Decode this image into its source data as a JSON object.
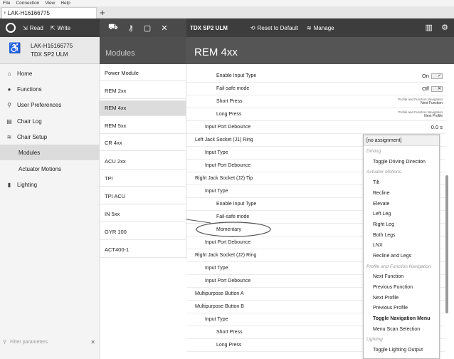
{
  "menubar": [
    "File",
    "Connection",
    "View",
    "Help"
  ],
  "tab": {
    "label": "LAK-H16166775",
    "new_tab": "+"
  },
  "toolbar": {
    "read_label": "Read",
    "write_label": "Write",
    "device_title": "TDX SP2 ULM",
    "reset_label": "Reset to Default",
    "manage_label": "Manage"
  },
  "device": {
    "name": "LAK-H16166775",
    "model": "TDX SP2 ULM"
  },
  "modules_header": "Modules",
  "page_title": "REM 4xx",
  "nav": [
    {
      "label": "Home",
      "icon": "home-icon",
      "glyph": "⌂"
    },
    {
      "label": "Functions",
      "icon": "functions-icon",
      "glyph": "●"
    },
    {
      "label": "User Preferences",
      "icon": "user-icon",
      "glyph": "⚲"
    },
    {
      "label": "Chair Log",
      "icon": "log-icon",
      "glyph": "▤"
    },
    {
      "label": "Chair Setup",
      "icon": "setup-icon",
      "glyph": "≋"
    },
    {
      "label": "Modules",
      "icon": "",
      "glyph": ""
    },
    {
      "label": "Actuator Motions",
      "icon": "",
      "glyph": ""
    },
    {
      "label": "Lighting",
      "icon": "lighting-icon",
      "glyph": "▮"
    }
  ],
  "filter_placeholder": "Filter parameters",
  "modules": [
    "Power Module",
    "REM 2xx",
    "REM 4xx",
    "REM 5xx",
    "CR 4xx",
    "ACU 2xx",
    "TPI",
    "TPI ACU",
    "IN 5xx",
    "GYR 100",
    "ACT400-1"
  ],
  "params": [
    {
      "label": "Enable Input Type",
      "indent": 2,
      "value": "On",
      "check": "✓"
    },
    {
      "label": "Fail-safe mode",
      "indent": 2,
      "value": "Off",
      "check": "✕"
    },
    {
      "label": "Short Press",
      "indent": 2,
      "small_top": "Profile and Function Navigation",
      "small_bottom": "Next Function"
    },
    {
      "label": "Long Press",
      "indent": 2,
      "small_top": "Profile and Function Navigation",
      "small_bottom": "Next Profile"
    },
    {
      "label": "Input Port Debounce",
      "indent": 1,
      "value": "0.0 s"
    },
    {
      "label": "Left Jack Socket (J1) Ring",
      "indent": 0
    },
    {
      "label": "Input Type",
      "indent": 1
    },
    {
      "label": "Input Port Debounce",
      "indent": 1
    },
    {
      "label": "Right Jack Socket (J2) Tip",
      "indent": 0
    },
    {
      "label": "Input Type",
      "indent": 1
    },
    {
      "label": "Enable Input Type",
      "indent": 2
    },
    {
      "label": "Fail-safe mode",
      "indent": 2
    },
    {
      "label": "Momentary",
      "indent": 2
    },
    {
      "label": "Input Port Debounce",
      "indent": 1
    },
    {
      "label": "Right Jack Socket (J2) Ring",
      "indent": 0
    },
    {
      "label": "Input Type",
      "indent": 1
    },
    {
      "label": "Input Port Debounce",
      "indent": 1
    },
    {
      "label": "Multipurpose Button A",
      "indent": 0
    },
    {
      "label": "Multipurpose Button B",
      "indent": 0
    },
    {
      "label": "Input Type",
      "indent": 1
    },
    {
      "label": "Short Press",
      "indent": 2
    },
    {
      "label": "Long Press",
      "indent": 2
    }
  ],
  "dropdown": [
    {
      "label": "[no assignment]",
      "kind": "first"
    },
    {
      "label": "Driving",
      "kind": "group"
    },
    {
      "label": "Toggle Driving Direction",
      "kind": "item"
    },
    {
      "label": "Actuator Motions",
      "kind": "group"
    },
    {
      "label": "Tilt",
      "kind": "item"
    },
    {
      "label": "Recline",
      "kind": "item"
    },
    {
      "label": "Elevate",
      "kind": "item"
    },
    {
      "label": "Left Leg",
      "kind": "item"
    },
    {
      "label": "Right Leg",
      "kind": "item"
    },
    {
      "label": "Both Legs",
      "kind": "item"
    },
    {
      "label": "LNX",
      "kind": "item"
    },
    {
      "label": "Recline and Legs",
      "kind": "item"
    },
    {
      "label": "Profile and Function Navigation",
      "kind": "group"
    },
    {
      "label": "Next Function",
      "kind": "item"
    },
    {
      "label": "Previous Function",
      "kind": "item"
    },
    {
      "label": "Next Profile",
      "kind": "item"
    },
    {
      "label": "Previous Profile",
      "kind": "item"
    },
    {
      "label": "Toggle Navigation Menu",
      "kind": "bold"
    },
    {
      "label": "Menu Scan Selection",
      "kind": "item"
    },
    {
      "label": "Lighting",
      "kind": "group"
    },
    {
      "label": "Toggle Lighting Output",
      "kind": "item"
    }
  ],
  "colors": {
    "toolbar": "#3d3d3d",
    "band_modules": "#4f4f4f",
    "band_title": "#555555",
    "selected": "#dcdcdc"
  }
}
